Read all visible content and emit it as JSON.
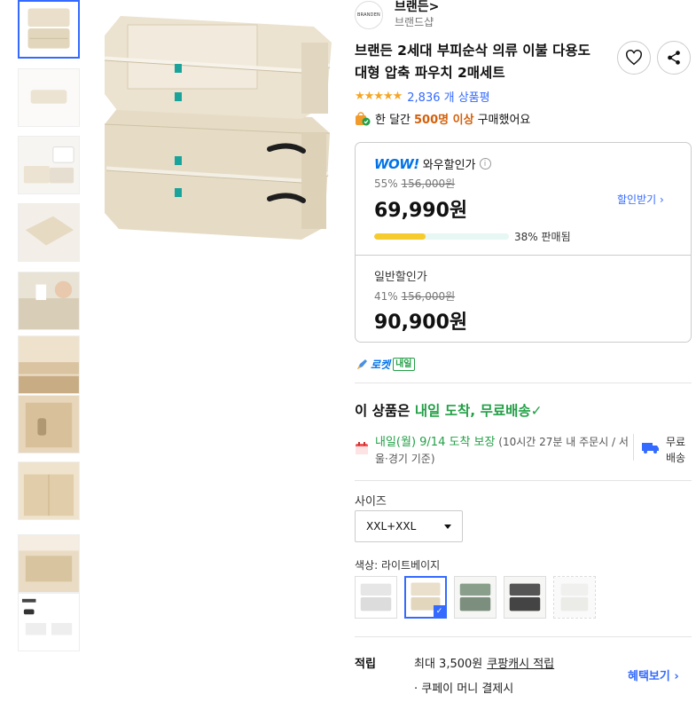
{
  "brand": {
    "logo_text": "BRANDEN",
    "name": "브랜든",
    "name_arrow": ">",
    "shop_label": "브랜드샵"
  },
  "product": {
    "title": "브랜든 2세대 부피순삭 의류 이불 다용도 대형 압축 파우치 2매세트",
    "stars": "★★★★★",
    "review_count": "2,836 개 상품평",
    "bought_prefix": "한 달간",
    "bought_highlight": "500명 이상",
    "bought_suffix": "구매했어요"
  },
  "actions": {
    "wishlist_icon": "heart-icon",
    "share_icon": "share-icon"
  },
  "wow_price": {
    "logo": "WOW!",
    "label": "와우할인가",
    "discount_rate": "55%",
    "original_price": "156,000원",
    "price": "69,990원",
    "coupon_label": "할인받기",
    "sold_percent": 38,
    "sold_label": "38% 판매됨"
  },
  "regular_price": {
    "label": "일반할인가",
    "discount_rate": "41%",
    "original_price": "156,000원",
    "price": "90,900원"
  },
  "rocket": {
    "label": "로켓",
    "badge": "내일"
  },
  "delivery": {
    "headline_prefix": "이 상품은",
    "headline_green": "내일 도착, 무료배송",
    "headline_check": "✓",
    "arrival_green": "내일(월) 9/14 도착 보장",
    "arrival_note": "(10시간 27분 내 주문시 / 서울·경기 기준)",
    "free_ship_line1": "무료",
    "free_ship_line2": "배송"
  },
  "options": {
    "size_label": "사이즈",
    "size_value": "XXL+XXL",
    "color_label": "색상:",
    "color_value": "라이트베이지"
  },
  "points": {
    "label": "적립",
    "text": "최대 3,500원",
    "link": "쿠팡캐시 적립",
    "sub": "· 쿠페이 머니 결제시",
    "benefit_link": "혜택보기"
  },
  "colors": {
    "accent": "#346aff",
    "green": "#23a047",
    "orange": "#d4600b",
    "wow_blue": "#0073e9",
    "progress": "#f6cb2d",
    "beige": "#e9dfca"
  }
}
